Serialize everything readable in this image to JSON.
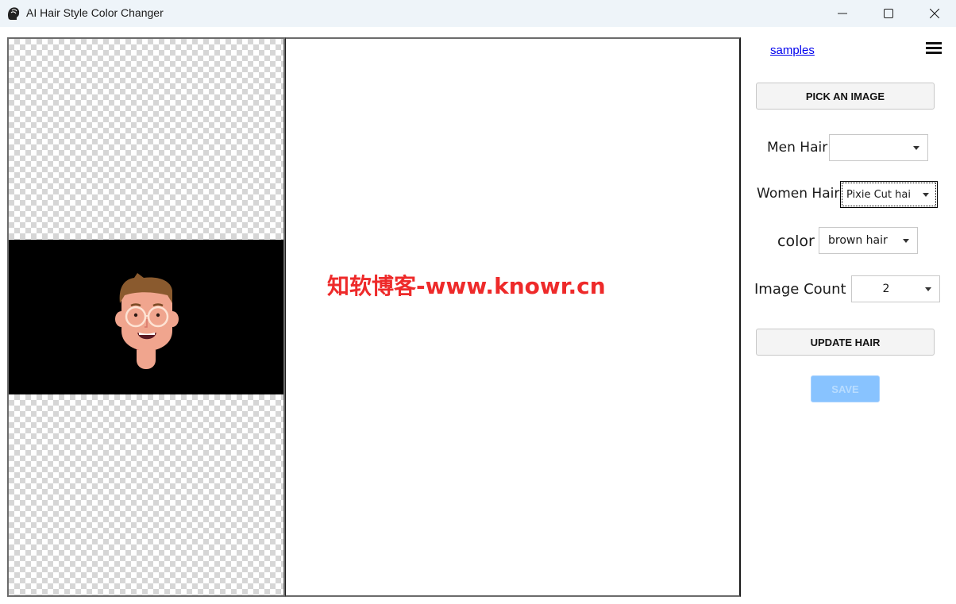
{
  "window": {
    "title": "AI Hair Style Color Changer",
    "controls": {
      "minimize": "minimize",
      "maximize": "maximize",
      "close": "close"
    }
  },
  "canvas": {
    "watermark": "知软博客-www.knowr.cn"
  },
  "sidebar": {
    "samples_link": "samples",
    "pick_button": "PICK AN IMAGE",
    "men_hair": {
      "label": "Men Hair",
      "value": ""
    },
    "women_hair": {
      "label": "Women Hair",
      "value": "Pixie Cut hai"
    },
    "color": {
      "label": "color",
      "value": "brown hair"
    },
    "image_count": {
      "label": "Image Count",
      "value": "2"
    },
    "update_button": "UPDATE HAIR",
    "save_button": "SAVE"
  },
  "colors": {
    "watermark": "#ee2a2a",
    "save_disabled": "#88c3ff",
    "link": "#0000ee"
  }
}
